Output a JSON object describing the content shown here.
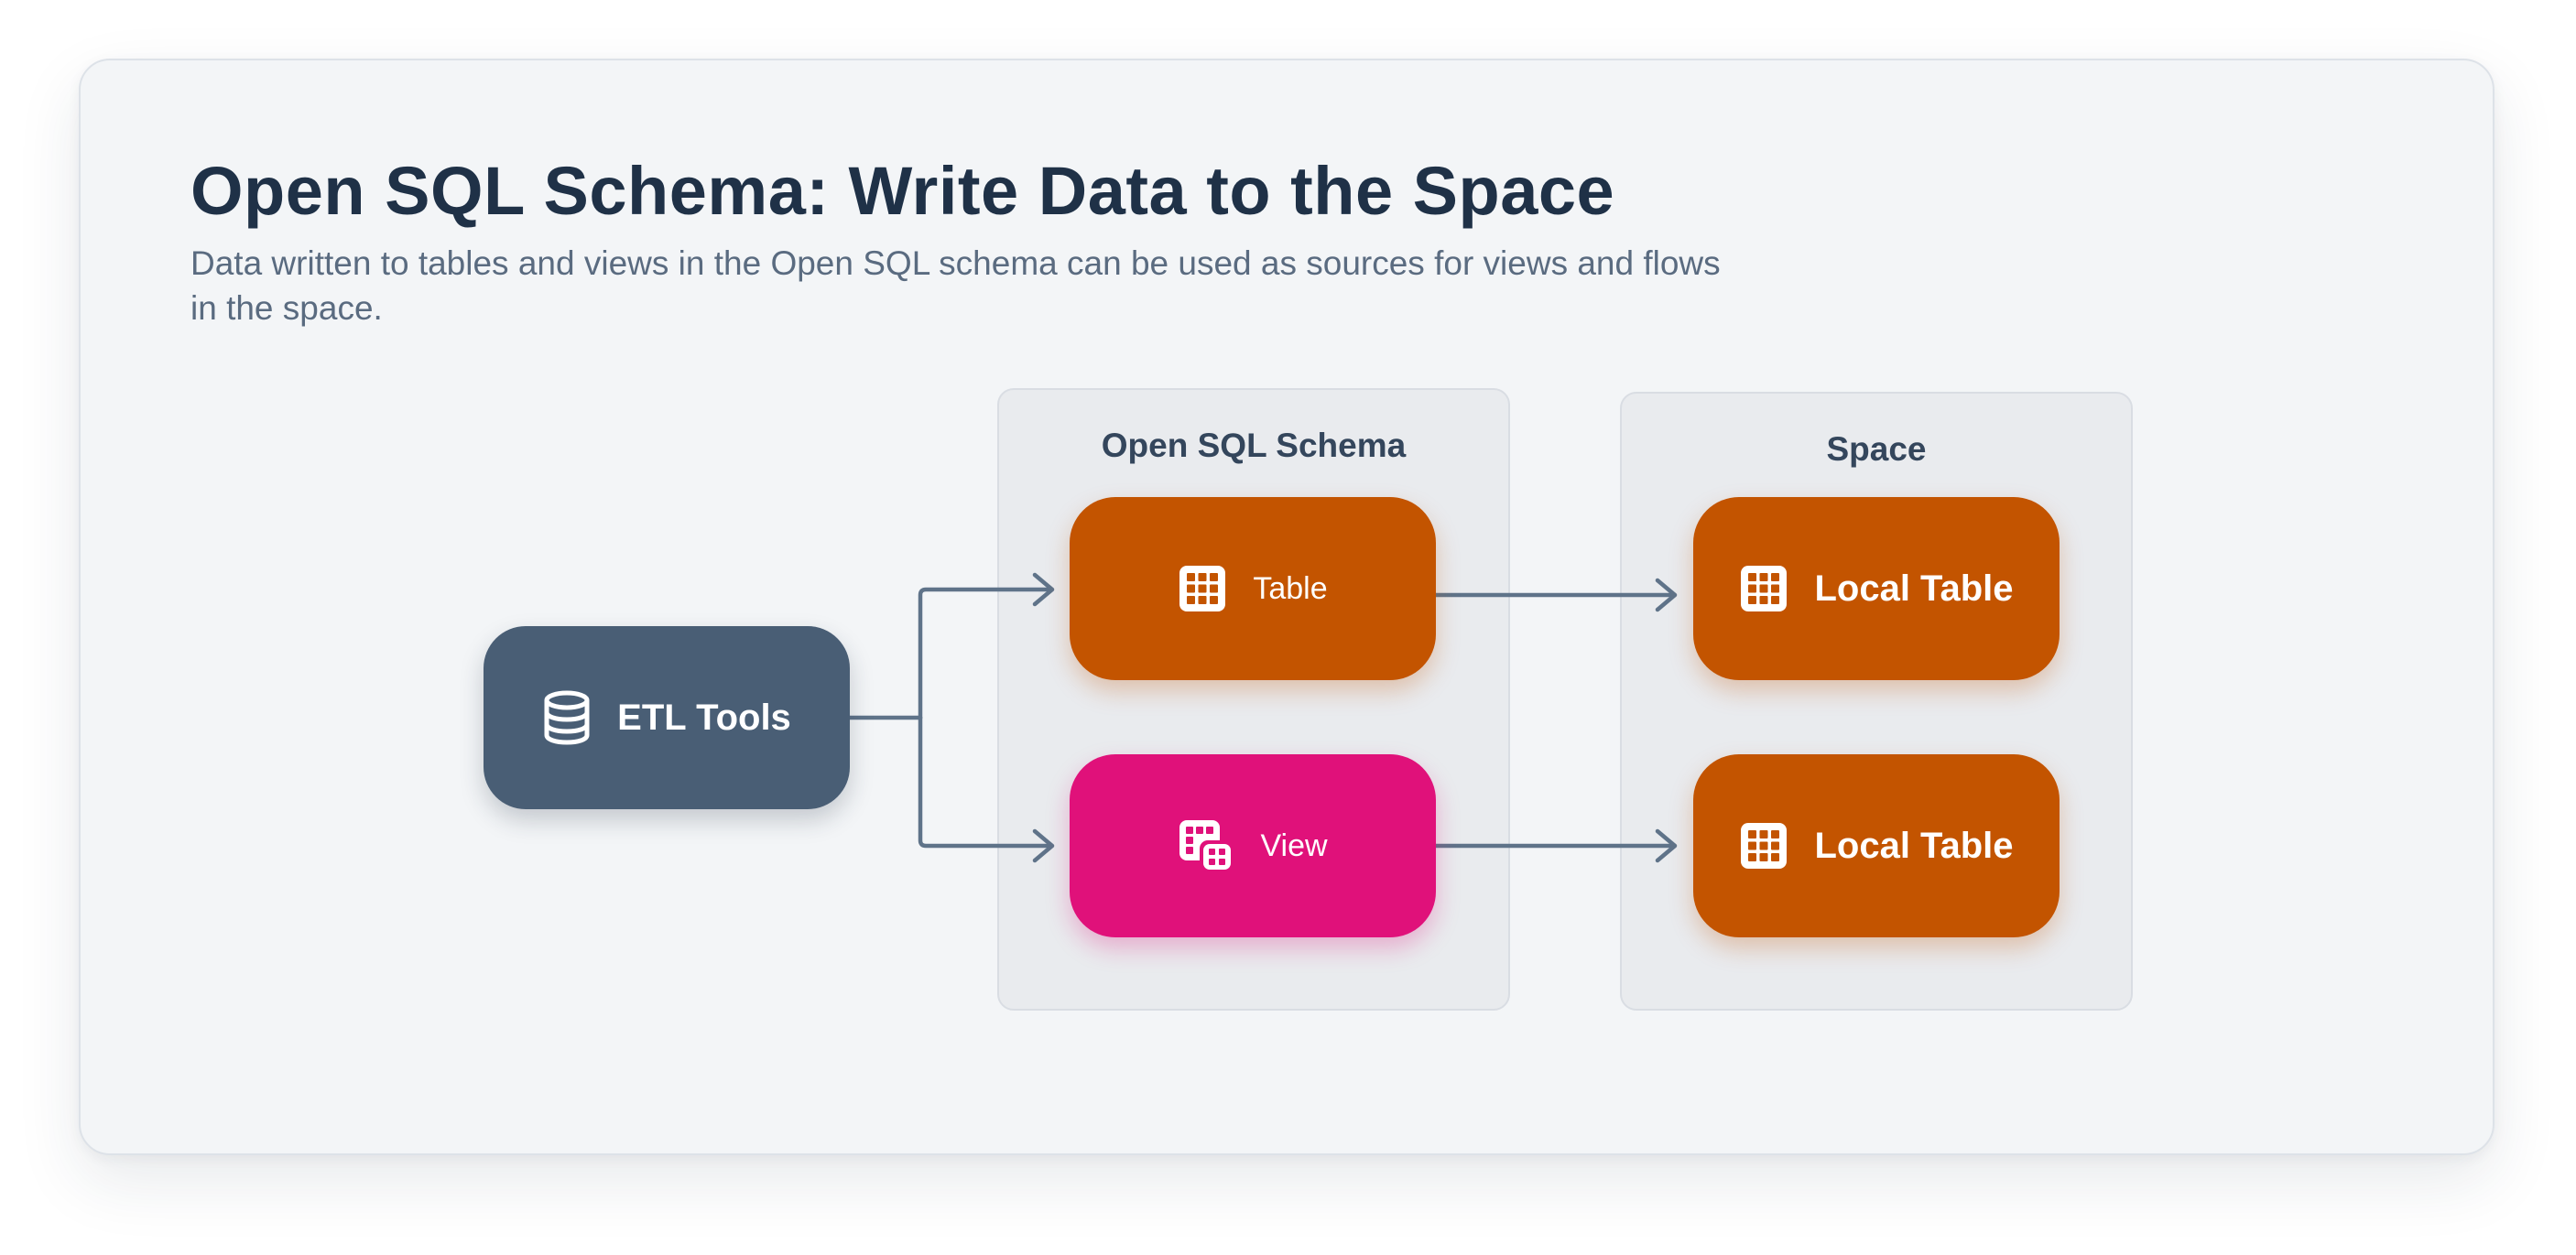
{
  "header": {
    "title": "Open SQL Schema: Write Data to the Space",
    "subtitle": "Data written to tables and views in the Open SQL schema can be used as sources for views and flows in the space."
  },
  "groups": {
    "open_sql_schema": {
      "label": "Open SQL Schema"
    },
    "space": {
      "label": "Space"
    }
  },
  "nodes": {
    "etl_tools": {
      "label": "ETL Tools",
      "icon": "database-icon",
      "color": "#495e75"
    },
    "table": {
      "label": "Table",
      "icon": "table-grid-icon",
      "color": "#c35400"
    },
    "view": {
      "label": "View",
      "icon": "view-icon",
      "color": "#e0117a"
    },
    "local_table_1": {
      "label": "Local Table",
      "icon": "table-grid-icon",
      "color": "#c35400"
    },
    "local_table_2": {
      "label": "Local Table",
      "icon": "table-grid-icon",
      "color": "#c35400"
    }
  },
  "colors": {
    "connector": "#5f7389",
    "card_background": "#f3f5f7",
    "group_background": "#e9ebee"
  }
}
